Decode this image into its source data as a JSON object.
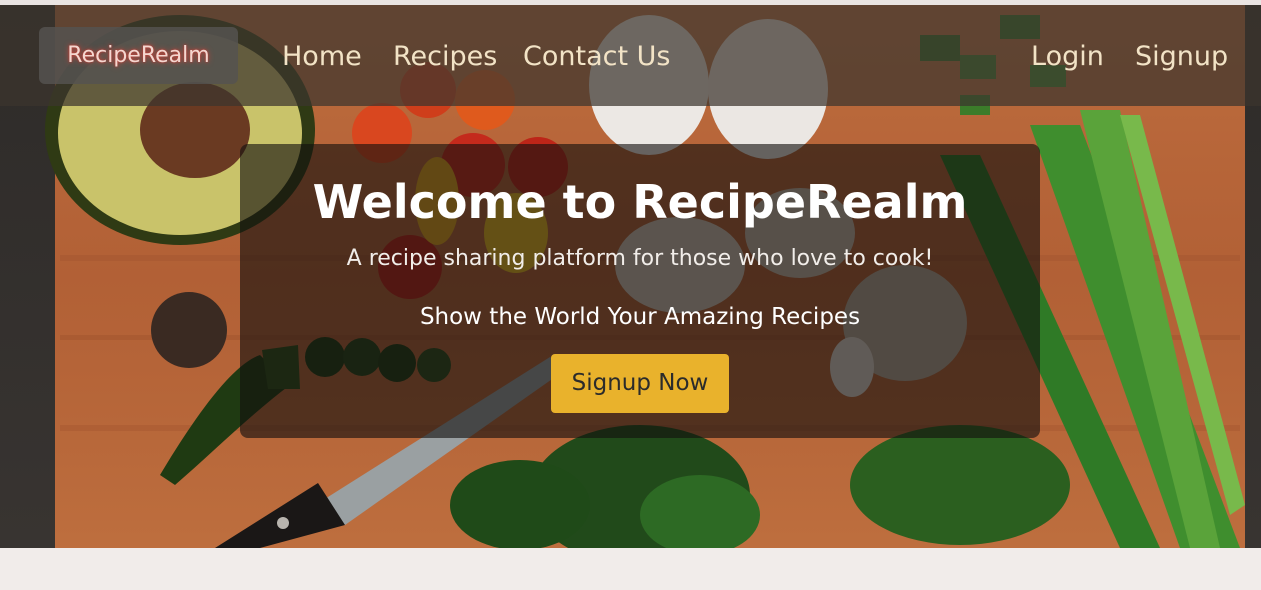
{
  "navbar": {
    "brand": "RecipeRealm",
    "links": [
      "Home",
      "Recipes",
      "Contact Us"
    ],
    "auth_links": [
      "Login",
      "Signup"
    ]
  },
  "hero": {
    "title": "Welcome to RecipeRealm",
    "subtitle": "A recipe sharing platform for those who love to cook!",
    "tagline": "Show the World Your Amazing Recipes",
    "cta_label": "Signup Now"
  },
  "colors": {
    "accent": "#e9b22c",
    "page_background": "#f1ecea",
    "nav_text": "#f2e3c6"
  }
}
